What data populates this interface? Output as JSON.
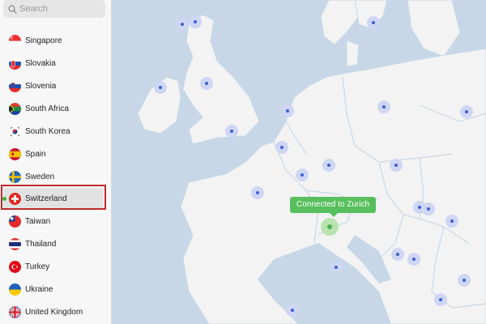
{
  "search": {
    "placeholder": "Search"
  },
  "countries": [
    {
      "label": "Singapore",
      "flag": "singapore-flag-icon"
    },
    {
      "label": "Slovakia",
      "flag": "slovakia-flag-icon"
    },
    {
      "label": "Slovenia",
      "flag": "slovenia-flag-icon"
    },
    {
      "label": "South Africa",
      "flag": "south-africa-flag-icon"
    },
    {
      "label": "South Korea",
      "flag": "south-korea-flag-icon"
    },
    {
      "label": "Spain",
      "flag": "spain-flag-icon"
    },
    {
      "label": "Sweden",
      "flag": "sweden-flag-icon"
    },
    {
      "label": "Switzerland",
      "flag": "switzerland-flag-icon",
      "selected": true,
      "connected": true
    },
    {
      "label": "Taiwan",
      "flag": "taiwan-flag-icon"
    },
    {
      "label": "Thailand",
      "flag": "thailand-flag-icon"
    },
    {
      "label": "Turkey",
      "flag": "turkey-flag-icon"
    },
    {
      "label": "Ukraine",
      "flag": "ukraine-flag-icon"
    },
    {
      "label": "United Kingdom",
      "flag": "united-kingdom-flag-icon"
    }
  ],
  "map": {
    "status_label": "Connected to Zurich",
    "colors": {
      "sea": "#c7d7e7",
      "land": "#f3f3f3",
      "border": "#c9d8e6",
      "server_halo": "#cfd6f4",
      "server_dot": "#3c5fd8",
      "connected_halo": "#b9e3ae",
      "connected_dot": "#4bb34f",
      "status_bg": "#58bf5d"
    }
  }
}
